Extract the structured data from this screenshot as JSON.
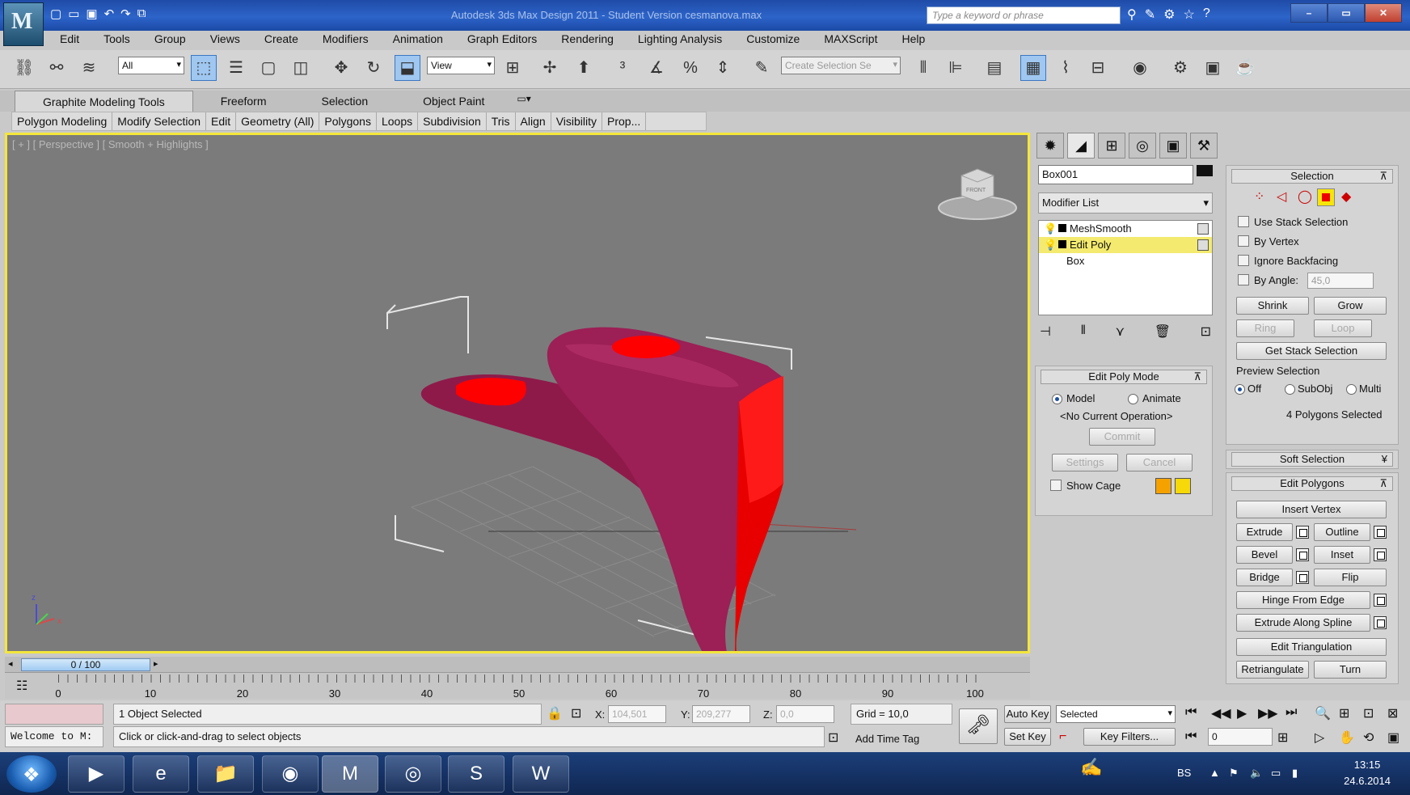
{
  "title": "Autodesk 3ds Max Design 2011 - Student Version  cesmanova.max",
  "search_placeholder": "Type a keyword or phrase",
  "menu": [
    "Edit",
    "Tools",
    "Group",
    "Views",
    "Create",
    "Modifiers",
    "Animation",
    "Graph Editors",
    "Rendering",
    "Lighting Analysis",
    "Customize",
    "MAXScript",
    "Help"
  ],
  "toolbar": {
    "filter": "All",
    "ref_coord": "View",
    "named_selection": "Create Selection Se"
  },
  "ribbon": {
    "tabs": [
      "Graphite Modeling Tools",
      "Freeform",
      "Selection",
      "Object Paint"
    ],
    "panels": [
      "Polygon Modeling",
      "Modify Selection",
      "Edit",
      "Geometry (All)",
      "Polygons",
      "Loops",
      "Subdivision",
      "Tris",
      "Align",
      "Visibility",
      "Prop..."
    ]
  },
  "viewport": {
    "label": "[ + ] [ Perspective ] [ Smooth + Highlights ]",
    "viewcube_label": "FRONT",
    "axis": {
      "x": "x",
      "y": "y",
      "z": "z"
    }
  },
  "command_panel": {
    "object_name": "Box001",
    "modifier_list": "Modifier List",
    "stack": [
      "MeshSmooth",
      "Edit Poly",
      "Box"
    ]
  },
  "edit_poly_mode": {
    "title": "Edit Poly Mode",
    "model": "Model",
    "animate": "Animate",
    "status": "<No Current Operation>",
    "commit": "Commit",
    "settings": "Settings",
    "cancel": "Cancel",
    "show_cage": "Show Cage",
    "cage_colors": [
      "#f5a200",
      "#f7d808"
    ]
  },
  "selection": {
    "title": "Selection",
    "use_stack": "Use Stack Selection",
    "by_vertex": "By Vertex",
    "ignore_backfacing": "Ignore Backfacing",
    "by_angle": "By Angle:",
    "angle_value": "45,0",
    "shrink": "Shrink",
    "grow": "Grow",
    "ring": "Ring",
    "loop": "Loop",
    "get_stack": "Get Stack Selection",
    "preview": "Preview Selection",
    "off": "Off",
    "subobj": "SubObj",
    "multi": "Multi",
    "status": "4 Polygons Selected"
  },
  "soft_selection": {
    "title": "Soft Selection"
  },
  "edit_polygons": {
    "title": "Edit Polygons",
    "insert_vertex": "Insert Vertex",
    "extrude": "Extrude",
    "outline": "Outline",
    "bevel": "Bevel",
    "inset": "Inset",
    "bridge": "Bridge",
    "flip": "Flip",
    "hinge": "Hinge From Edge",
    "extrude_spline": "Extrude Along Spline",
    "edit_tri": "Edit Triangulation",
    "retriangulate": "Retriangulate",
    "turn": "Turn"
  },
  "timeline": {
    "frame": "0 / 100",
    "ticks": [
      "0",
      "10",
      "20",
      "30",
      "40",
      "50",
      "60",
      "70",
      "80",
      "90",
      "100"
    ]
  },
  "status": {
    "listener": "Welcome to M:",
    "selected": "1 Object Selected",
    "prompt": "Click or click-and-drag to select objects",
    "x_label": "X:",
    "x_value": "104,501",
    "y_label": "Y:",
    "y_value": "209,277",
    "z_label": "Z:",
    "z_value": "0,0",
    "grid": "Grid = 10,0",
    "add_time_tag": "Add Time Tag",
    "auto_key": "Auto Key",
    "set_key": "Set Key",
    "key_mode": "Selected",
    "key_filters": "Key Filters...",
    "frame_value": "0"
  },
  "taskbar": {
    "lang": "BS",
    "time": "13:15",
    "date": "24.6.2014"
  },
  "colors": {
    "viewport_border": "#f4e63a",
    "model": "#9c1f55",
    "selected_face": "#ff0000"
  }
}
